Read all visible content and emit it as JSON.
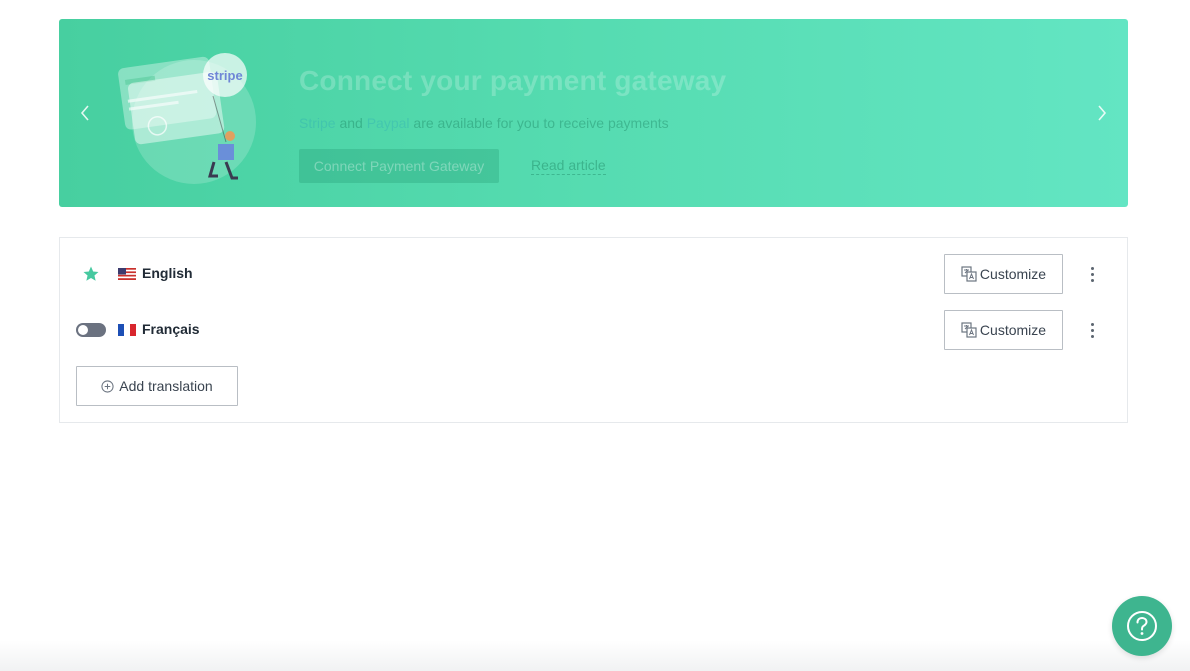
{
  "banner": {
    "title": "Connect your payment gateway",
    "subtitle_stripe": "Stripe",
    "subtitle_and": " and ",
    "subtitle_paypal": "Paypal",
    "subtitle_rest": " are available for you to receive payments",
    "cta_label": "Connect Payment Gateway",
    "link_label": "Read article",
    "illustration_text": "stripe",
    "prev_icon": "chevron-left-icon",
    "next_icon": "chevron-right-icon"
  },
  "languages": [
    {
      "name": "English",
      "default": true,
      "flag": "us-flag-icon",
      "customize_label": "Customize"
    },
    {
      "name": "Français",
      "default": false,
      "enabled": false,
      "flag": "fr-flag-icon",
      "customize_label": "Customize"
    }
  ],
  "add_translation_label": "Add translation",
  "help_icon": "question-icon",
  "colors": {
    "accent": "#47cfa0",
    "star": "#47c9a0",
    "help_button": "#3eb58f"
  }
}
